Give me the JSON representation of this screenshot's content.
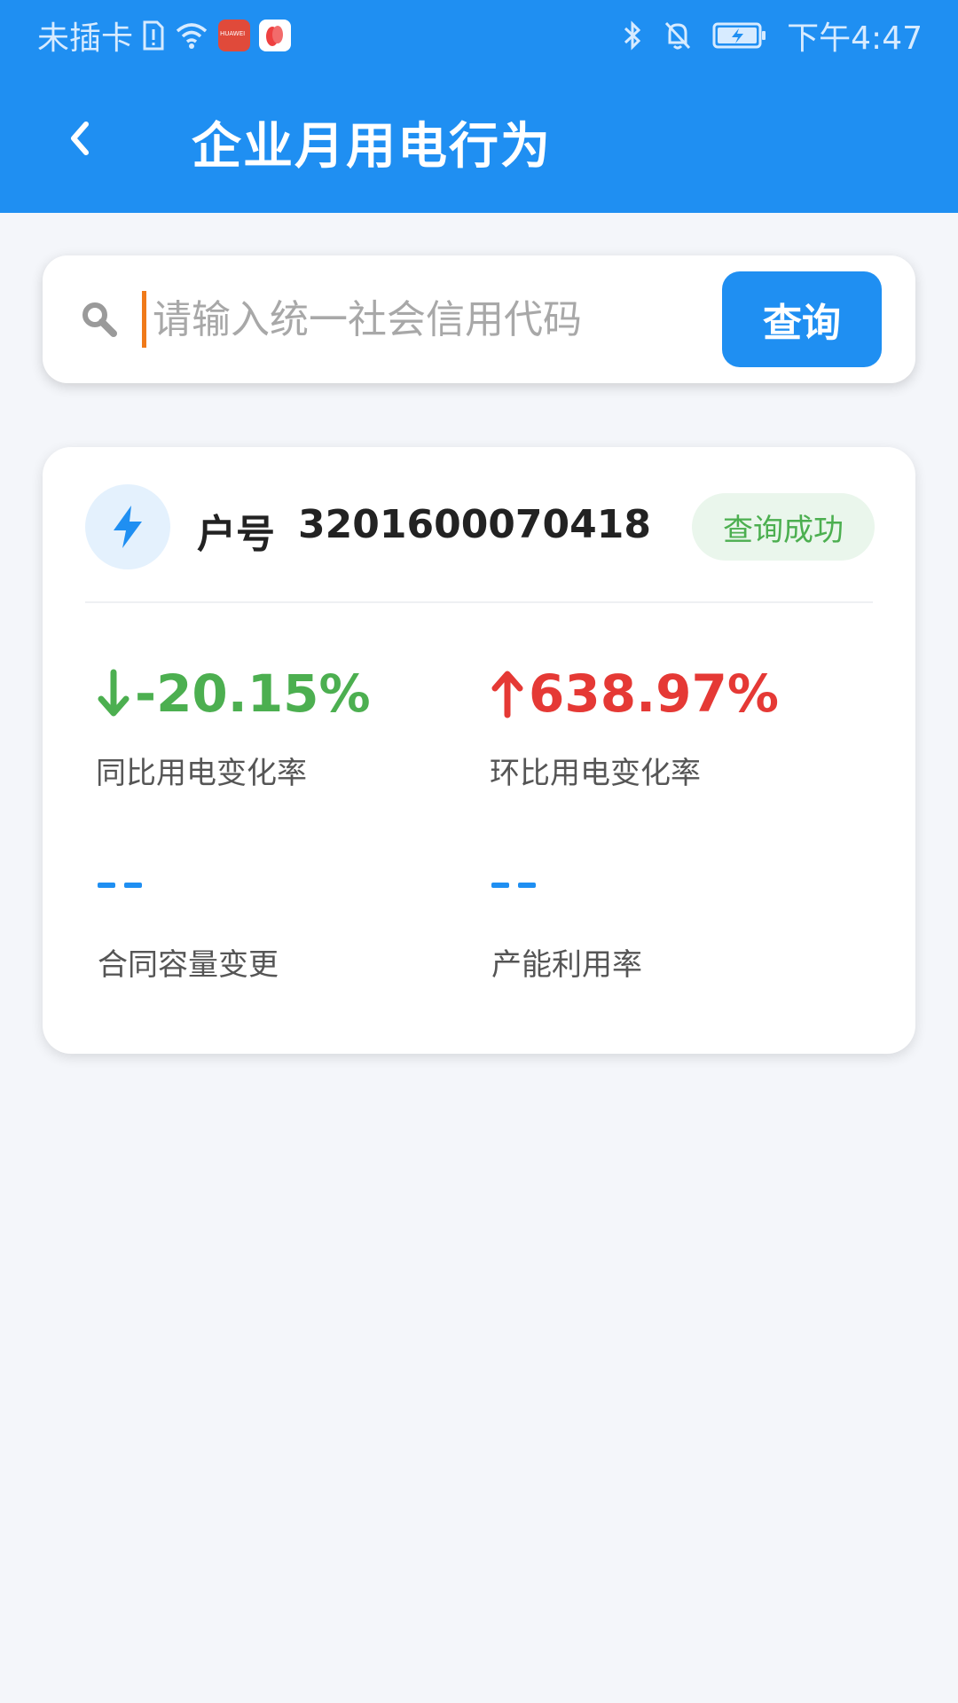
{
  "status_bar": {
    "carrier": "未插卡",
    "time": "下午4:47",
    "huawei_badge": "HUAWEI",
    "colors": {
      "huawei_app": "#e04a3a",
      "red_app": "#ee4040"
    }
  },
  "header": {
    "title": "企业月用电行为",
    "background": "#1f8ff2"
  },
  "search": {
    "placeholder": "请输入统一社会信用代码",
    "value": "",
    "button_label": "查询"
  },
  "result": {
    "account_label": "户号",
    "account_number": "3201600070418",
    "status": "查询成功",
    "metrics": [
      {
        "value": "-20.15%",
        "direction": "down",
        "label": "同比用电变化率",
        "color": "#4caf50"
      },
      {
        "value": "638.97%",
        "direction": "up",
        "label": "环比用电变化率",
        "color": "#e53935"
      },
      {
        "value": "--",
        "label": "合同容量变更"
      },
      {
        "value": "--",
        "label": "产能利用率"
      }
    ]
  },
  "icons": {
    "back": "chevron-left-icon",
    "search": "magnifier-icon",
    "account": "lightning-bolt-icon",
    "arrow_down": "arrow-down-icon",
    "arrow_up": "arrow-up-icon"
  }
}
